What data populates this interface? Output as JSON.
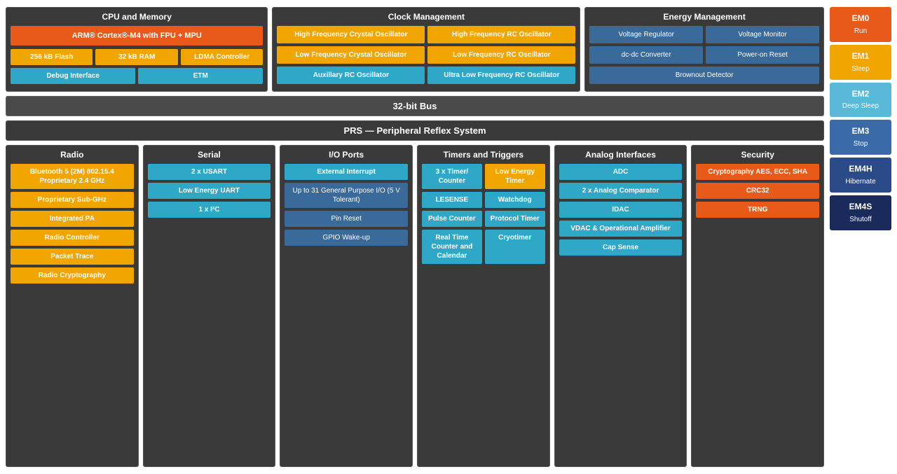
{
  "cpu": {
    "title": "CPU and Memory",
    "arm": "ARM® Cortex®-M4 with FPU + MPU",
    "chips": [
      {
        "label": "256 kB Flash",
        "color": "yellow"
      },
      {
        "label": "32 kB RAM",
        "color": "yellow"
      },
      {
        "label": "LDMA Controller",
        "color": "yellow"
      },
      {
        "label": "Debug Interface",
        "color": "blue"
      },
      {
        "label": "ETM",
        "color": "blue"
      }
    ]
  },
  "clock": {
    "title": "Clock Management",
    "chips": [
      {
        "label": "High Frequency Crystal Oscillator",
        "color": "yellow"
      },
      {
        "label": "High Frequency RC Oscillator",
        "color": "yellow"
      },
      {
        "label": "Low Frequency Crystal Oscillator",
        "color": "yellow"
      },
      {
        "label": "Low Frequency RC Oscillator",
        "color": "yellow"
      },
      {
        "label": "Auxillary RC Oscillator",
        "color": "blue"
      },
      {
        "label": "Ultra Low Frequency RC Oscillator",
        "color": "blue"
      }
    ]
  },
  "energy": {
    "title": "Energy Management",
    "chips": [
      {
        "label": "Voltage Regulator",
        "color": "dark"
      },
      {
        "label": "Voltage Monitor",
        "color": "dark"
      },
      {
        "label": "dc-dc Converter",
        "color": "dark"
      },
      {
        "label": "Power-on Reset",
        "color": "dark"
      },
      {
        "label": "Brownout Detector",
        "color": "dark",
        "full": true
      }
    ]
  },
  "bus": {
    "label": "32-bit Bus"
  },
  "prs": {
    "label": "PRS — Peripheral Reflex System"
  },
  "radio": {
    "title": "Radio",
    "chips": [
      {
        "label": "Bluetooth 5 (2M) 802.15.4 Proprietary 2.4 GHz",
        "color": "yellow"
      },
      {
        "label": "Proprietary Sub-GHz",
        "color": "yellow"
      },
      {
        "label": "Integrated PA",
        "color": "yellow"
      },
      {
        "label": "Radio Controller",
        "color": "yellow"
      },
      {
        "label": "Packet Trace",
        "color": "yellow"
      },
      {
        "label": "Radio Cryptography",
        "color": "yellow"
      }
    ]
  },
  "serial": {
    "title": "Serial",
    "chips": [
      {
        "label": "2 x USART",
        "color": "blue"
      },
      {
        "label": "Low Energy UART",
        "color": "blue"
      },
      {
        "label": "1 x I²C",
        "color": "blue"
      }
    ]
  },
  "io": {
    "title": "I/O Ports",
    "chips": [
      {
        "label": "External Interrupt",
        "color": "blue"
      },
      {
        "label": "Up to 31 General Purpose I/O (5 V Tolerant)",
        "color": "dark"
      },
      {
        "label": "Pin Reset",
        "color": "dark"
      },
      {
        "label": "GPIO Wake-up",
        "color": "dark"
      }
    ]
  },
  "timers": {
    "title": "Timers and Triggers",
    "chips_left": [
      {
        "label": "3 x Timer/ Counter"
      },
      {
        "label": "LESENSE"
      },
      {
        "label": "Pulse Counter"
      },
      {
        "label": "Real Time Counter and Calendar"
      }
    ],
    "chips_right": [
      {
        "label": "Low Energy Timer"
      },
      {
        "label": "Watchdog"
      },
      {
        "label": "Protocol Timer"
      },
      {
        "label": "Cryotimer"
      }
    ]
  },
  "analog": {
    "title": "Analog Interfaces",
    "chips": [
      {
        "label": "ADC"
      },
      {
        "label": "2 x Analog Comparator"
      },
      {
        "label": "IDAC"
      },
      {
        "label": "VDAC & Operational Amplifier"
      },
      {
        "label": "Cap Sense"
      }
    ]
  },
  "security": {
    "title": "Security",
    "chips": [
      {
        "label": "Cryptography AES, ECC, SHA"
      },
      {
        "label": "CRC32"
      },
      {
        "label": "TRNG"
      }
    ]
  },
  "em": {
    "items": [
      {
        "id": "EM0",
        "sublabel": "Run",
        "class": "em0"
      },
      {
        "id": "EM1",
        "sublabel": "Sleep",
        "class": "em1"
      },
      {
        "id": "EM2",
        "sublabel": "Deep Sleep",
        "class": "em2"
      },
      {
        "id": "EM3",
        "sublabel": "Stop",
        "class": "em3"
      },
      {
        "id": "EM4H",
        "sublabel": "Hibernate",
        "class": "em4h"
      },
      {
        "id": "EM4S",
        "sublabel": "Shutoff",
        "class": "em4s"
      }
    ]
  }
}
